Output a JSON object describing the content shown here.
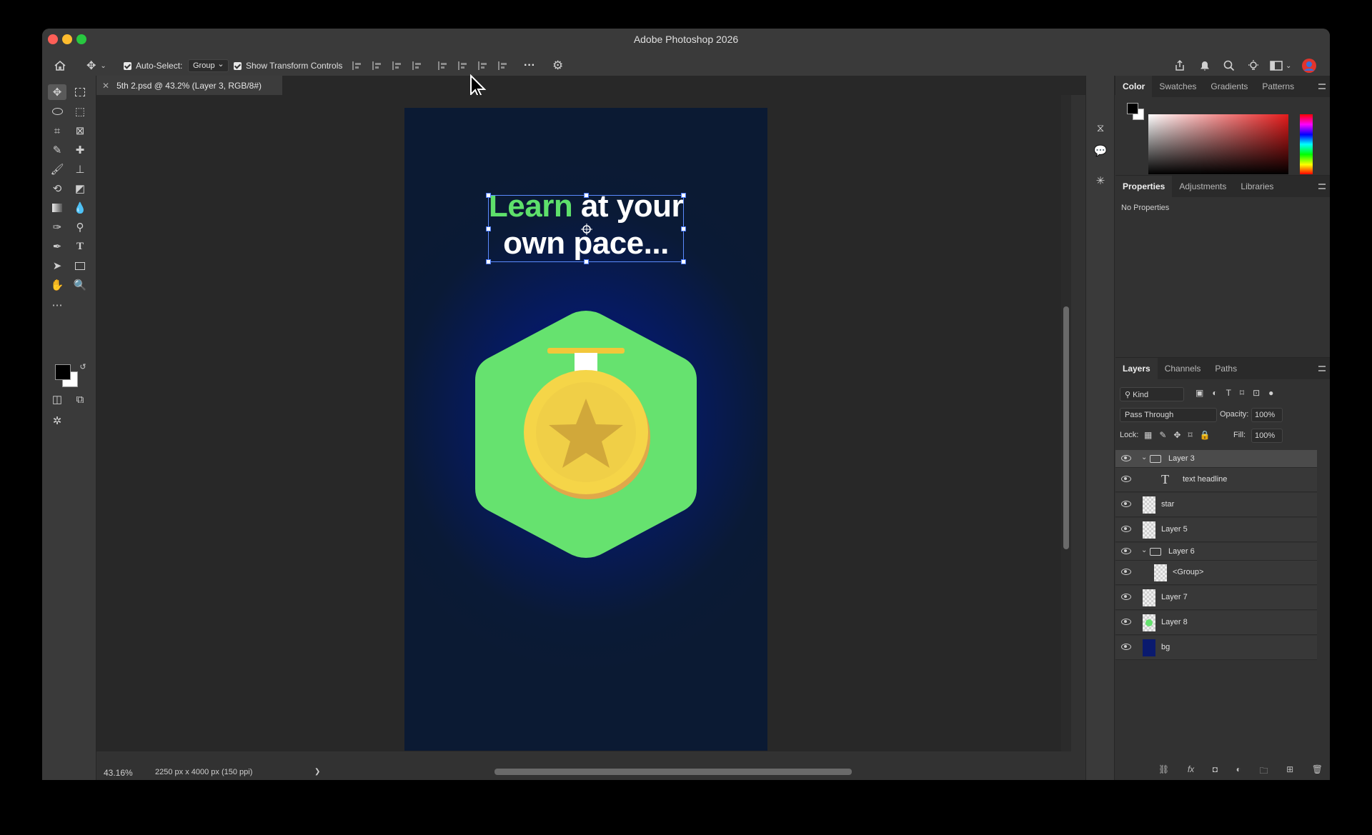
{
  "app": {
    "title": "Adobe Photoshop 2026"
  },
  "options_bar": {
    "auto_select_label": "Auto-Select:",
    "auto_select_value": "Group",
    "transform_label": "Show Transform Controls",
    "more_icon": "···"
  },
  "document": {
    "tab_label": "5th 2.psd @ 43.2% (Layer 3, RGB/8#)"
  },
  "canvas": {
    "headline_green": "Learn",
    "headline_rest": " at your",
    "headline_line2": "own pace...",
    "colors": {
      "green": "#5ee06b",
      "badge_green": "#66e26f",
      "gold": "#f5d548",
      "gold_dark": "#d9b13a"
    }
  },
  "status": {
    "zoom": "43.16%",
    "doc_size": "2250 px x 4000 px (150 ppi)",
    "arrow": "❯"
  },
  "color_panel": {
    "tabs": [
      "Color",
      "Swatches",
      "Gradients",
      "Patterns"
    ]
  },
  "properties_panel": {
    "tabs": [
      "Properties",
      "Adjustments",
      "Libraries"
    ],
    "empty_text": "No Properties"
  },
  "layers_panel": {
    "tabs": [
      "Layers",
      "Channels",
      "Paths"
    ],
    "filter_kind": "Kind",
    "blend_mode": "Pass Through",
    "opacity_label": "Opacity:",
    "opacity_value": "100%",
    "lock_label": "Lock:",
    "fill_label": "Fill:",
    "fill_value": "100%",
    "layers": [
      {
        "name": "Layer 3",
        "kind": "group"
      },
      {
        "name": "text headline",
        "kind": "text"
      },
      {
        "name": "star",
        "kind": "pixel"
      },
      {
        "name": "Layer 5",
        "kind": "pixel"
      },
      {
        "name": "Layer 6",
        "kind": "group"
      },
      {
        "name": "<Group>",
        "kind": "pixel"
      },
      {
        "name": "Layer 7",
        "kind": "pixel"
      },
      {
        "name": "Layer 8",
        "kind": "pixel"
      },
      {
        "name": "bg",
        "kind": "fill"
      }
    ]
  }
}
